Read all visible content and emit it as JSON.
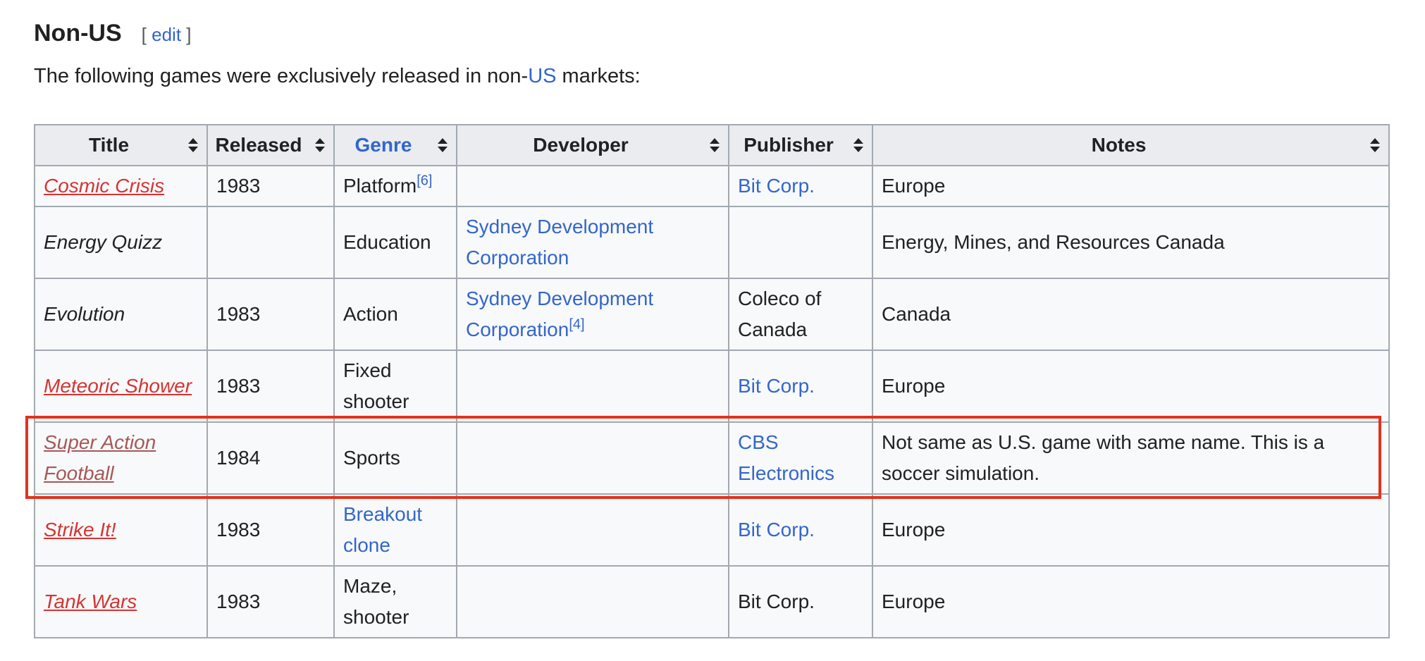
{
  "section": {
    "title": "Non-US",
    "edit_open": "[",
    "edit_label": "edit",
    "edit_close": "]",
    "intro_before": "The following games were exclusively released in non-",
    "intro_link": "US",
    "intro_after": " markets:"
  },
  "table": {
    "headers": [
      "Title",
      "Released",
      "Genre",
      "Developer",
      "Publisher",
      "Notes"
    ],
    "rows": [
      {
        "title": "Cosmic Crisis",
        "released": "1983",
        "genre": "Platform",
        "genre_ref": "[6]",
        "developer": "",
        "developer_ref": "",
        "publisher": "Bit Corp.",
        "notes": "Europe"
      },
      {
        "title": "Energy Quizz",
        "released": "",
        "genre": "Education",
        "genre_ref": "",
        "developer": "Sydney Development Corporation",
        "developer_ref": "",
        "publisher": "",
        "notes": "Energy, Mines, and Resources Canada"
      },
      {
        "title": "Evolution",
        "released": "1983",
        "genre": "Action",
        "genre_ref": "",
        "developer": "Sydney Development Corporation",
        "developer_ref": "[4]",
        "publisher": "Coleco of Canada",
        "notes": "Canada"
      },
      {
        "title": "Meteoric Shower",
        "released": "1983",
        "genre": "Fixed shooter",
        "genre_ref": "",
        "developer": "",
        "developer_ref": "",
        "publisher": "Bit Corp.",
        "notes": "Europe"
      },
      {
        "title": "Super Action Football",
        "released": "1984",
        "genre": "Sports",
        "genre_ref": "",
        "developer": "",
        "developer_ref": "",
        "publisher": "CBS Electronics",
        "notes": "Not same as U.S. game with same name. This is a soccer simulation."
      },
      {
        "title": "Strike It!",
        "released": "1983",
        "genre": "Breakout clone",
        "genre_ref": "",
        "developer": "",
        "developer_ref": "",
        "publisher": "Bit Corp.",
        "notes": "Europe"
      },
      {
        "title": "Tank Wars",
        "released": "1983",
        "genre": "Maze, shooter",
        "genre_ref": "",
        "developer": "",
        "developer_ref": "",
        "publisher": "Bit Corp.",
        "notes": "Europe"
      }
    ]
  },
  "colors": {
    "link": "#3366cc",
    "redlink": "#d73333",
    "visited_redlink": "#a55858",
    "header_bg": "#eaecf0",
    "cell_bg": "#f8f9fa",
    "border": "#a2a9b1",
    "highlight": "#e3321c"
  },
  "icons": {
    "sort": "sort-up-down-icon"
  }
}
